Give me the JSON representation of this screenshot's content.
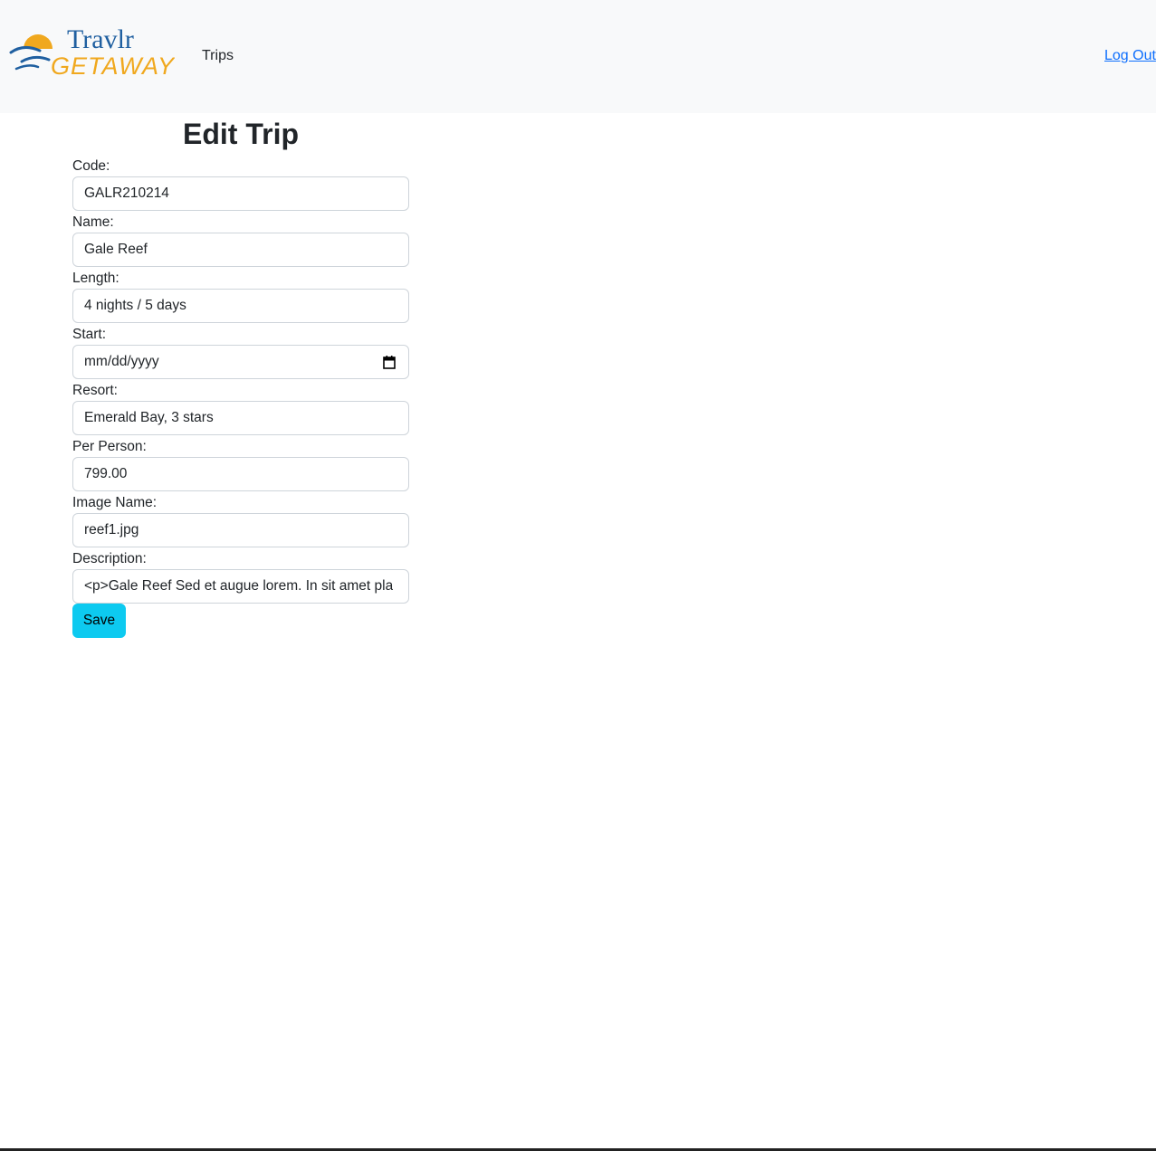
{
  "brand": {
    "name_top": "Travlr",
    "name_bottom": "GETAWAYS",
    "colors": {
      "blue": "#1f5fa0",
      "orange": "#f0a81e"
    }
  },
  "nav": {
    "trips_label": "Trips",
    "logout_label": "Log Out"
  },
  "page": {
    "title": "Edit Trip"
  },
  "form": {
    "fields": [
      {
        "label": "Code:",
        "value": "GALR210214"
      },
      {
        "label": "Name:",
        "value": "Gale Reef"
      },
      {
        "label": "Length:",
        "value": "4 nights / 5 days"
      },
      {
        "label": "Start:",
        "value": "mm/dd/yyyy",
        "icon": "calendar-icon"
      },
      {
        "label": "Resort:",
        "value": "Emerald Bay, 3 stars"
      },
      {
        "label": "Per Person:",
        "value": "799.00"
      },
      {
        "label": "Image Name:",
        "value": "reef1.jpg"
      },
      {
        "label": "Description:",
        "value": "<p>Gale Reef Sed et augue lorem. In sit amet pla"
      }
    ],
    "save_label": "Save",
    "accent": "#0dcaf0"
  }
}
